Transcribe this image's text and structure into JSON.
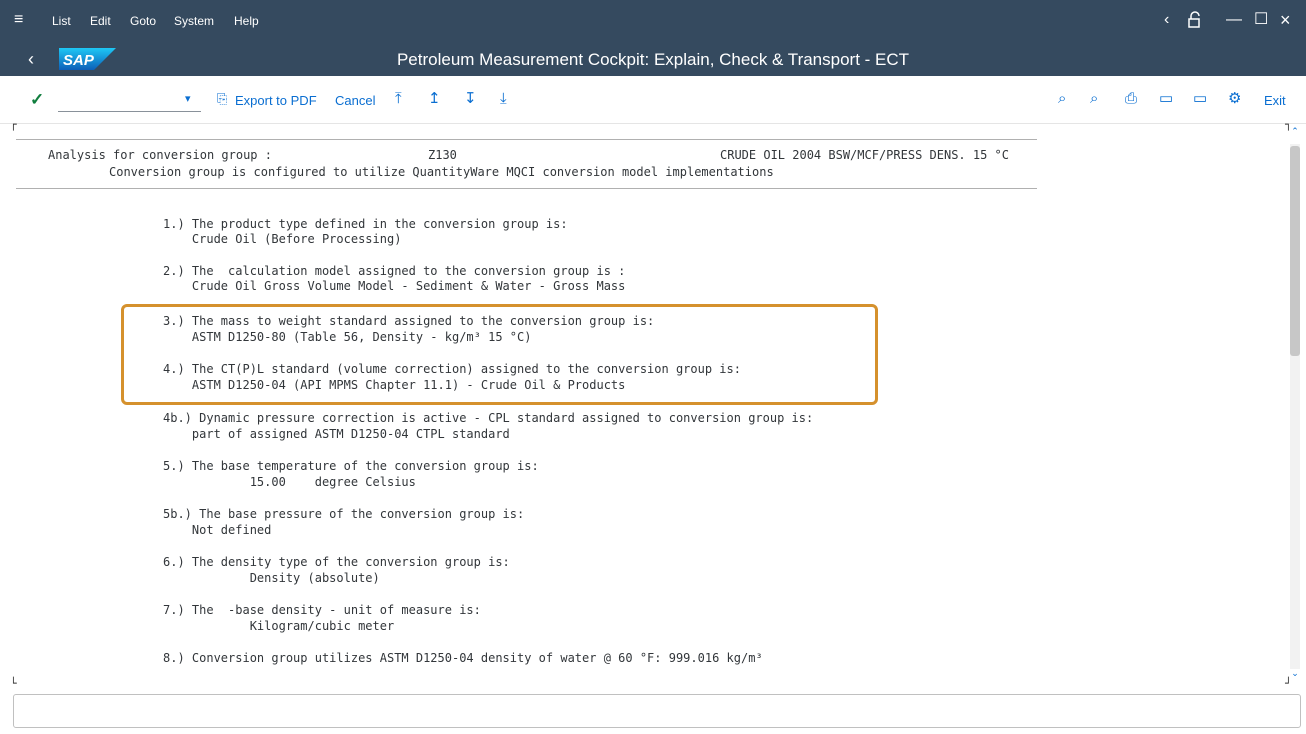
{
  "menubar": {
    "items": [
      "List",
      "Edit",
      "Goto",
      "System",
      "Help"
    ],
    "controls": [
      "‹",
      "⌂",
      "—",
      "☐",
      "×"
    ]
  },
  "titlebar": {
    "logo": "SAP",
    "title": "Petroleum Measurement Cockpit: Explain, Check & Transport - ECT"
  },
  "toolbar": {
    "okcode_value": "",
    "export_label": "Export to PDF",
    "cancel_label": "Cancel",
    "exit_label": "Exit"
  },
  "report": {
    "header_label": "Analysis for conversion group :",
    "group_code": "Z130",
    "group_desc": "CRUDE OIL 2004 BSW/MCF/PRESS DENS. 15 °C",
    "header_note": "Conversion group is configured to utilize QuantityWare MQCI conversion model implementations",
    "lines": [
      "1.) The product type defined in the conversion group is:",
      "    Crude Oil (Before Processing)",
      "2.) The  calculation model assigned to the conversion group is :",
      "    Crude Oil Gross Volume Model - Sediment & Water - Gross Mass",
      "3.) The mass to weight standard assigned to the conversion group is:",
      "    ASTM D1250-80 (Table 56, Density - kg/m³ 15 °C)",
      "4.) The CT(P)L standard (volume correction) assigned to the conversion group is:",
      "    ASTM D1250-04 (API MPMS Chapter 11.1) - Crude Oil & Products",
      "4b.) Dynamic pressure correction is active - CPL standard assigned to conversion group is:",
      "    part of assigned ASTM D1250-04 CTPL standard",
      "5.) The base temperature of the conversion group is:",
      "            15.00    degree Celsius",
      "5b.) The base pressure of the conversion group is:",
      "    Not defined",
      "6.) The density type of the conversion group is:",
      "            Density (absolute)",
      "7.) The  -base density - unit of measure is:",
      "            Kilogram/cubic meter",
      "8.) Conversion group utilizes ASTM D1250-04 density of water @ 60 °F: 999.016 kg/m³"
    ]
  },
  "colors": {
    "shell": "#354a5f",
    "accent": "#0a6ed1",
    "highlight": "#d5912d",
    "ok_green": "#107e3e"
  }
}
